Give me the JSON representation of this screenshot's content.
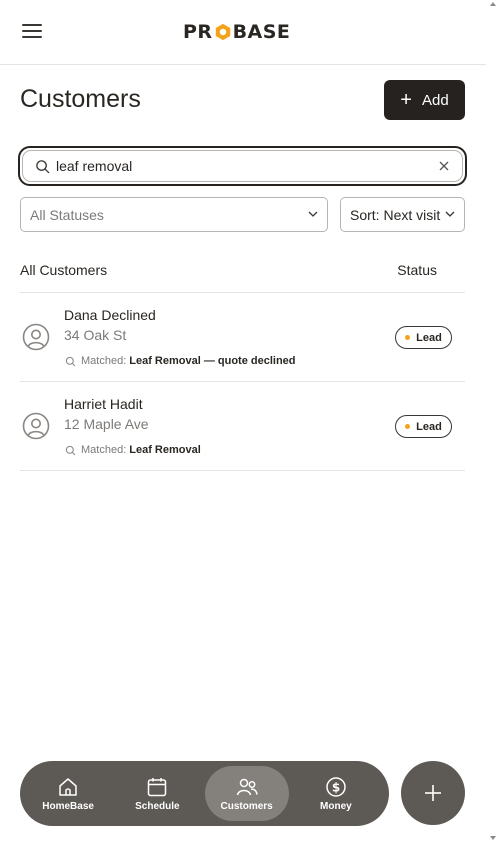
{
  "brand": {
    "logo_text_left": "PR",
    "logo_text_right": "BASE",
    "logo_accent": "#f5a21b"
  },
  "header": {
    "title": "Customers",
    "add_label": "Add"
  },
  "search": {
    "value": "leaf removal",
    "icon": "search-icon",
    "clear_icon": "close-icon"
  },
  "filters": {
    "status_selected": "All Statuses",
    "sort_selected": "Sort: Next visit"
  },
  "list": {
    "header_label": "All Customers",
    "status_column": "Status",
    "customers": [
      {
        "name": "Dana Declined",
        "address": "34 Oak St",
        "matched_label": "Matched:",
        "matched_value": "Leaf Removal — quote declined",
        "status": "Lead"
      },
      {
        "name": "Harriet Hadit",
        "address": "12 Maple Ave",
        "matched_label": "Matched:",
        "matched_value": "Leaf Removal",
        "status": "Lead"
      }
    ]
  },
  "nav": {
    "items": [
      {
        "label": "HomeBase",
        "icon": "home-icon"
      },
      {
        "label": "Schedule",
        "icon": "calendar-icon"
      },
      {
        "label": "Customers",
        "icon": "users-icon",
        "active": true
      },
      {
        "label": "Money",
        "icon": "dollar-icon"
      }
    ],
    "fab_icon": "plus-icon"
  },
  "colors": {
    "primary_dark": "#26221f",
    "nav_bg": "#5d5955",
    "lead_dot": "#f5a21b"
  }
}
